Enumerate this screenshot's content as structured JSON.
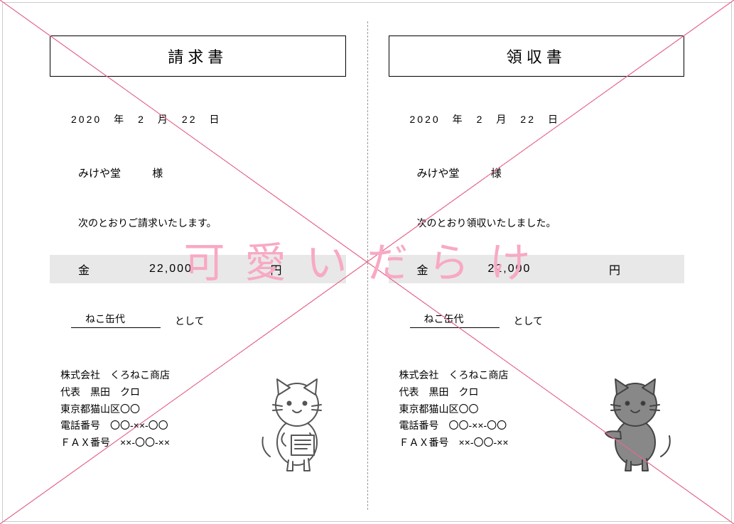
{
  "watermark": "可愛いだらけ",
  "left": {
    "title": "請求書",
    "date": "2020　年　2　月　22　日",
    "recipient": "みけや堂",
    "honorific": "様",
    "statement": "次のとおりご請求いたします。",
    "amount_label": "金",
    "amount_value": "22,000",
    "amount_unit": "円",
    "purpose": "ねこ缶代",
    "purpose_suffix": "として",
    "company": {
      "name": "株式会社　くろねこ商店",
      "rep": "代表　黒田　クロ",
      "address": "東京都猫山区〇〇",
      "tel": "電話番号　〇〇-××-〇〇",
      "fax": "ＦＡＸ番号　××-〇〇-××"
    }
  },
  "right": {
    "title": "領収書",
    "date": "2020　年　2　月　22　日",
    "recipient": "みけや堂",
    "honorific": "様",
    "statement": "次のとおり領収いたしました。",
    "amount_label": "金",
    "amount_value": "22,000",
    "amount_unit": "円",
    "purpose": "ねこ缶代",
    "purpose_suffix": "として",
    "company": {
      "name": "株式会社　くろねこ商店",
      "rep": "代表　黒田　クロ",
      "address": "東京都猫山区〇〇",
      "tel": "電話番号　〇〇-××-〇〇",
      "fax": "ＦＡＸ番号　××-〇〇-××"
    }
  }
}
